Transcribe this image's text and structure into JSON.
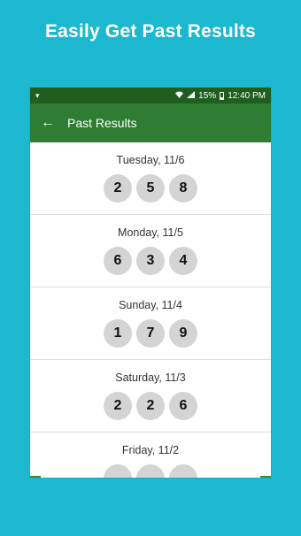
{
  "promo": {
    "title": "Easily Get Past Results"
  },
  "status_bar": {
    "battery": "15%",
    "time": "12:40 PM",
    "left_icon": "notification-icon",
    "wifi_icon": "wifi-icon",
    "signal_icon": "signal-icon"
  },
  "app_bar": {
    "back_icon": "arrow-left-icon",
    "title": "Past Results"
  },
  "results": [
    {
      "date": "Tuesday, 11/6",
      "numbers": [
        "2",
        "5",
        "8"
      ]
    },
    {
      "date": "Monday, 11/5",
      "numbers": [
        "6",
        "3",
        "4"
      ]
    },
    {
      "date": "Sunday, 11/4",
      "numbers": [
        "1",
        "7",
        "9"
      ]
    },
    {
      "date": "Saturday, 11/3",
      "numbers": [
        "2",
        "2",
        "6"
      ]
    },
    {
      "date": "Friday, 11/2",
      "numbers": [
        "",
        "",
        ""
      ]
    }
  ],
  "colors": {
    "background": "#1cb8cf",
    "status_bar": "#1f5e1f",
    "app_bar": "#2e7d32",
    "ball": "#d4d4d4"
  }
}
